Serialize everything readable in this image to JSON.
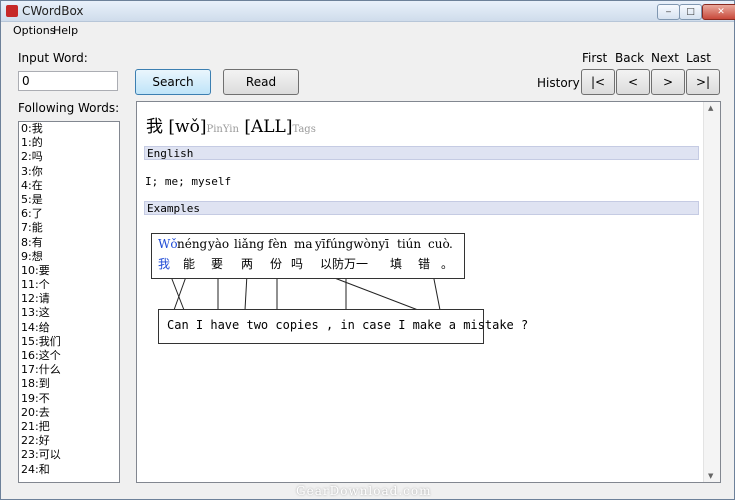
{
  "window": {
    "title": "CWordBox",
    "minimize_glyph": "‒",
    "maximize_glyph": "□",
    "close_glyph": "✕"
  },
  "menu": [
    "Options",
    "Help"
  ],
  "input_word": {
    "label": "Input Word:",
    "value": "0"
  },
  "following_words": {
    "label": "Following Words:",
    "items": [
      "0:我",
      "1:的",
      "2:吗",
      "3:你",
      "4:在",
      "5:是",
      "6:了",
      "7:能",
      "8:有",
      "9:想",
      "10:要",
      "11:个",
      "12:请",
      "13:这",
      "14:给",
      "15:我们",
      "16:这个",
      "17:什么",
      "18:到",
      "19:不",
      "20:去",
      "21:把",
      "22:好",
      "23:可以",
      "24:和"
    ]
  },
  "buttons": {
    "search": "Search",
    "read": "Read"
  },
  "history": {
    "label": "History",
    "nav_labels": [
      "First",
      "Back",
      "Next",
      "Last"
    ],
    "nav_buttons": [
      "|<",
      "<",
      ">",
      ">|"
    ]
  },
  "entry": {
    "hanzi": "我",
    "pinyin_open": "[",
    "pinyin": "wǒ",
    "pinyin_close": "]",
    "pinyin_tag": "PinYin",
    "tags_value": "[ALL]",
    "tags_tag": "Tags",
    "english_header": "English",
    "definition": "I; me; myself",
    "examples_header": "Examples"
  },
  "example": {
    "pinyin": [
      "Wǒ",
      "néng",
      "yào",
      "liǎng",
      "fèn",
      "ma",
      "yīfúngwònyī",
      "tiún",
      "cuò",
      "."
    ],
    "hanzi": [
      "我",
      "能",
      "要",
      "两",
      "份",
      "吗",
      "以防万一",
      "填",
      "错",
      "。"
    ],
    "english": "Can I have two copies , in case I make a mistake ?"
  },
  "scrollbar": {
    "up_glyph": "▲",
    "down_glyph": "▼"
  },
  "watermark": "GearDownload.com",
  "colors": {
    "highlight_blue": "#1f4bd6",
    "section_bg": "#dfe3f2"
  }
}
